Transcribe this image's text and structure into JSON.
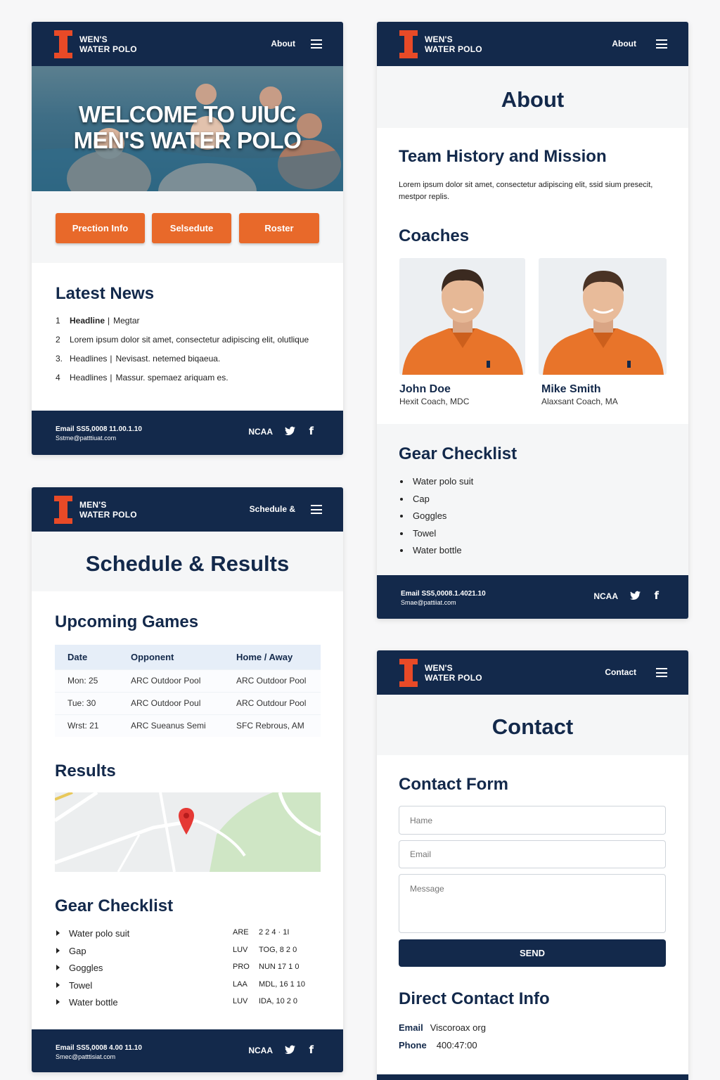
{
  "brand": {
    "line1": "WEN'S",
    "line2": "WATER POLO",
    "line1_b": "MEN'S"
  },
  "home": {
    "nav_link": "About",
    "hero_title_1": "WELCOME TO UIUC",
    "hero_title_2": "MEN'S WATER POLO",
    "buttons": [
      "Prection Info",
      "Selsedute",
      "Roster"
    ],
    "news_title": "Latest News",
    "news": [
      {
        "num": "1",
        "head": "Headline",
        "sep": "|",
        "text": "Megtar"
      },
      {
        "num": "2",
        "head": "",
        "sep": "",
        "text": "Lorem ipsum dolor sit amet, consectetur adipiscing elit, olutlique"
      },
      {
        "num": "3.",
        "head": "Headlines",
        "sep": "|",
        "text": "Nevisast. netemed biqaeua."
      },
      {
        "num": "4",
        "head": "Headlines",
        "sep": "|",
        "text": "Massur. spemaez ariquam es."
      }
    ],
    "footer": {
      "line1": "Email SS5,0008 11.00.1.10",
      "line2": "Sstme@patttiuat.com",
      "ncaa": "NCAA"
    }
  },
  "schedule": {
    "nav_link": "Schedule &",
    "banner": "Schedule & Results",
    "upcoming_title": "Upcoming Games",
    "columns": [
      "Date",
      "Opponent",
      "Home / Away"
    ],
    "rows": [
      [
        "Mon: 25",
        "ARC Outdoor Pool",
        "ARC Outdoor Pool"
      ],
      [
        "Tue: 30",
        "ARC Outdoor Poul",
        "ARC Outdour Pool"
      ],
      [
        "Wrst: 21",
        "ARC Sueanus Semi",
        "SFC Rebrous, AM"
      ]
    ],
    "results_title": "Results",
    "gear_title": "Gear Checklist",
    "gear": [
      {
        "item": "Water polo suit",
        "code": "ARE",
        "val": "2 2 4 · 1I"
      },
      {
        "item": "Gap",
        "code": "LUV",
        "val": "TOG, 8 2 0"
      },
      {
        "item": "Goggles",
        "code": "PRO",
        "val": "NUN 17 1 0"
      },
      {
        "item": "Towel",
        "code": "LAA",
        "val": "MDL, 16 1 10"
      },
      {
        "item": "Water bottle",
        "code": "LUV",
        "val": "IDA, 10 2 0"
      }
    ],
    "footer": {
      "line1": "Email SS5,0008 4.00 11.10",
      "line2": "Smec@patttisiat.com",
      "ncaa": "NCAA"
    }
  },
  "about": {
    "nav_link": "About",
    "banner": "About",
    "history_title": "Team History and Mission",
    "history_text": "Lorem ipsum dolor sit amet, consectetur adipiscing elit, ssid sium presecit, mestpor replis.",
    "coaches_title": "Coaches",
    "coaches": [
      {
        "name": "John Doe",
        "role": "Hexit Coach, MDC"
      },
      {
        "name": "Mike Smith",
        "role": "Alaxsant Coach, MA"
      }
    ],
    "gear_title": "Gear Checklist",
    "gear": [
      "Water polo suit",
      "Cap",
      "Goggles",
      "Towel",
      "Water bottle"
    ],
    "footer": {
      "line1": "Email SS5,0008.1.4021.10",
      "line2": "Smae@pattiiat.com",
      "ncaa": "NCAA"
    }
  },
  "contact": {
    "nav_link": "Contact",
    "banner": "Contact",
    "form_title": "Contact Form",
    "name_placeholder": "Hame",
    "email_placeholder": "Email",
    "message_placeholder": "Message",
    "send_label": "SEND",
    "direct_title": "Direct Contact Info",
    "email_label": "Email",
    "email_value": "Viscoroax org",
    "phone_label": "Phone",
    "phone_value": "400:47:00"
  },
  "colors": {
    "navy": "#13294b",
    "orange": "#e84a27",
    "button_orange": "#e8692a"
  }
}
